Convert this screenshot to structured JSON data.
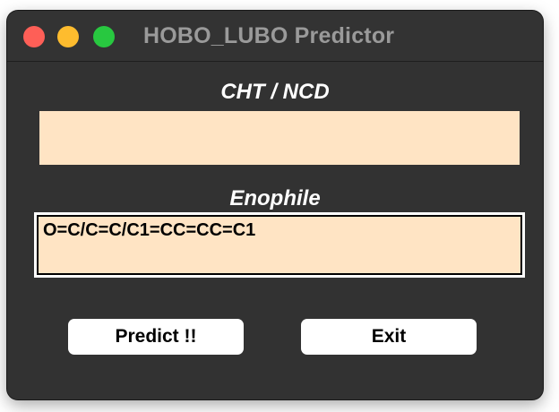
{
  "window": {
    "title": "HOBO_LUBO Predictor"
  },
  "cht_field": {
    "label": "CHT / NCD",
    "value": ""
  },
  "enophile_field": {
    "label": "Enophile",
    "value": "O=C/C=C/C1=CC=CC=C1"
  },
  "buttons": {
    "predict_label": "Predict !!",
    "exit_label": "Exit"
  },
  "colors": {
    "window_bg": "#323232",
    "text_area_bg": "#ffe4c4",
    "close": "#fe5f57",
    "minimize": "#febc2e",
    "maximize": "#28c840"
  }
}
